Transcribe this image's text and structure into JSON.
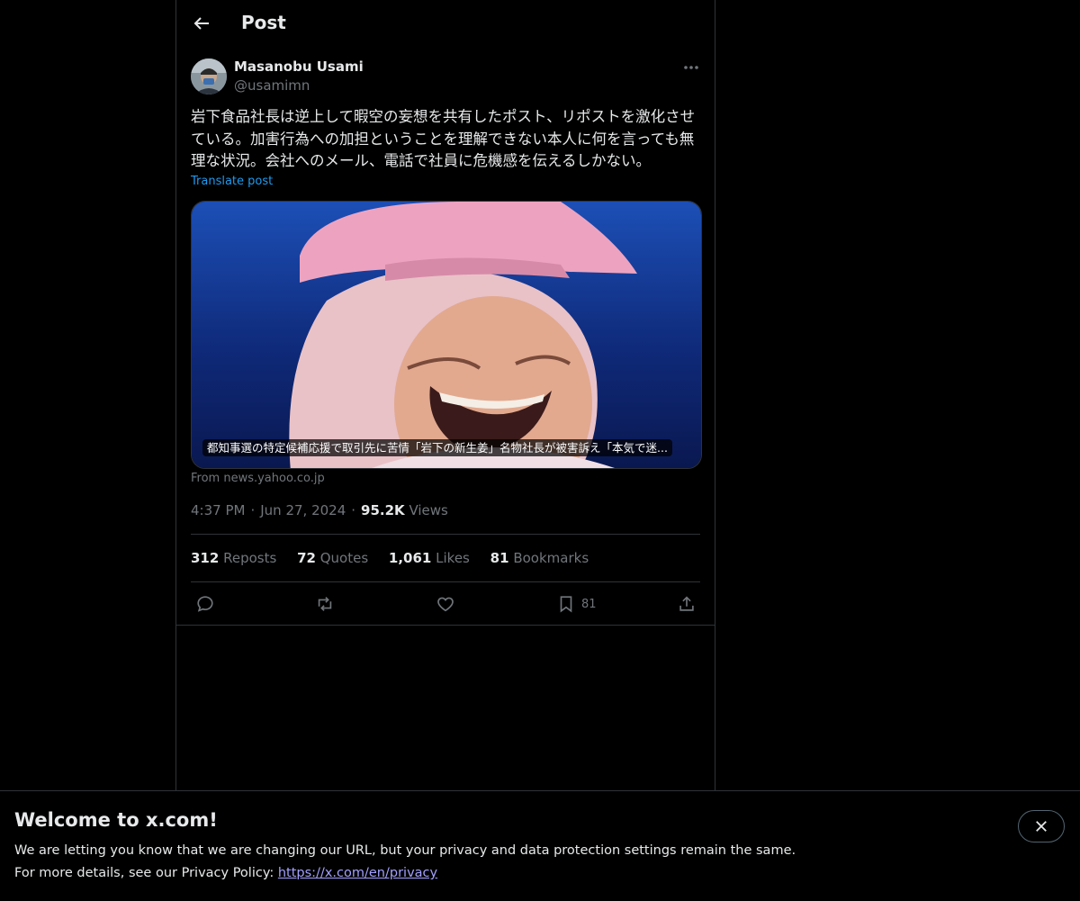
{
  "header": {
    "title": "Post"
  },
  "author": {
    "name": "Masanobu Usami",
    "handle": "@usamimn"
  },
  "post": {
    "text": "岩下食品社長は逆上して暇空の妄想を共有したポスト、リポストを激化させている。加害行為への加担ということを理解できない本人に何を言っても無理な状況。会社へのメール、電話で社員に危機感を伝えるしかない。",
    "translate_label": "Translate post",
    "card": {
      "caption": "都知事選の特定候補応援で取引先に苦情「岩下の新生姜」名物社長が被害訴え「本気で迷...",
      "source": "From news.yahoo.co.jp"
    },
    "time": "4:37 PM",
    "date": "Jun 27, 2024",
    "views_count": "95.2K",
    "views_label": "Views"
  },
  "stats": [
    {
      "count": "312",
      "label": "Reposts"
    },
    {
      "count": "72",
      "label": "Quotes"
    },
    {
      "count": "1,061",
      "label": "Likes"
    },
    {
      "count": "81",
      "label": "Bookmarks"
    }
  ],
  "actions": {
    "reply_icon": "reply-icon",
    "repost_icon": "repost-icon",
    "like_icon": "heart-icon",
    "bookmark_icon": "bookmark-icon",
    "bookmark_count": "81",
    "share_icon": "share-icon"
  },
  "banner": {
    "title": "Welcome to x.com!",
    "line1": "We are letting you know that we are changing our URL, but your privacy and data protection settings remain the same.",
    "line2_prefix": "For more details, see our Privacy Policy: ",
    "link": "https://x.com/en/privacy"
  },
  "colors": {
    "background": "#000000",
    "text": "#e7e9ea",
    "muted": "#71767b",
    "accent": "#1d9bf0",
    "border": "#2f3336",
    "link": "#a3a0ff"
  }
}
